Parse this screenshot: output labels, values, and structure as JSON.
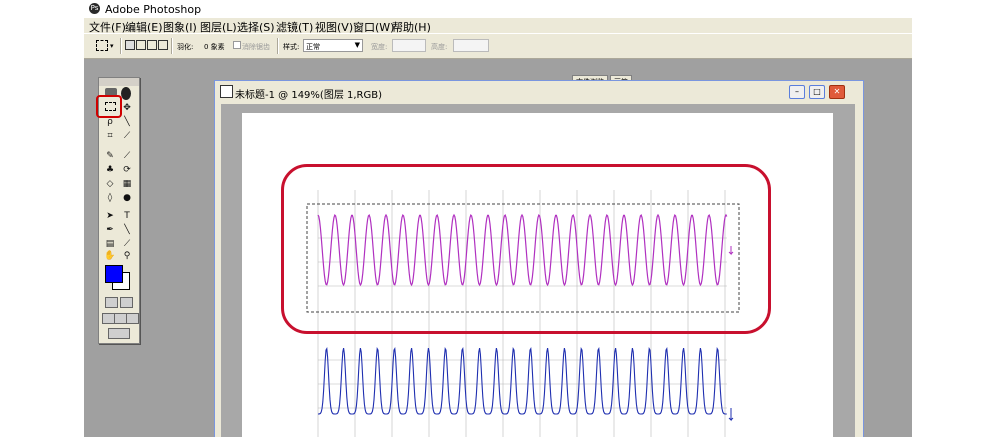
{
  "window": {
    "title": "Adobe Photoshop",
    "icon": "photoshop-icon"
  },
  "menu": [
    "文件(F)",
    "编辑(E)",
    "图象(I)",
    "图层(L)",
    "选择(S)",
    "滤镜(T)",
    "视图(V)",
    "窗口(W)",
    "帮助(H)"
  ],
  "options": {
    "feather_label": "羽化:",
    "feather_value": "0 象素",
    "antialias_label": "消除锯齿",
    "style_label": "样式:",
    "style_value": "正常",
    "width_label": "宽度:",
    "height_label": "高度:"
  },
  "palette_tabs": [
    "文件浏览",
    "画笔"
  ],
  "document": {
    "title": "未标题-1 @ 149%(图层 1,RGB)"
  },
  "toolbox": {
    "foreground_color": "#0000ff",
    "background_color": "#ffffff",
    "selected_tool": "rectangular-marquee-tool"
  },
  "annotations": {
    "highlight_color": "#c8102e"
  },
  "waveforms": {
    "top_color": "#b030c0",
    "bottom_color": "#1f2fb0"
  }
}
